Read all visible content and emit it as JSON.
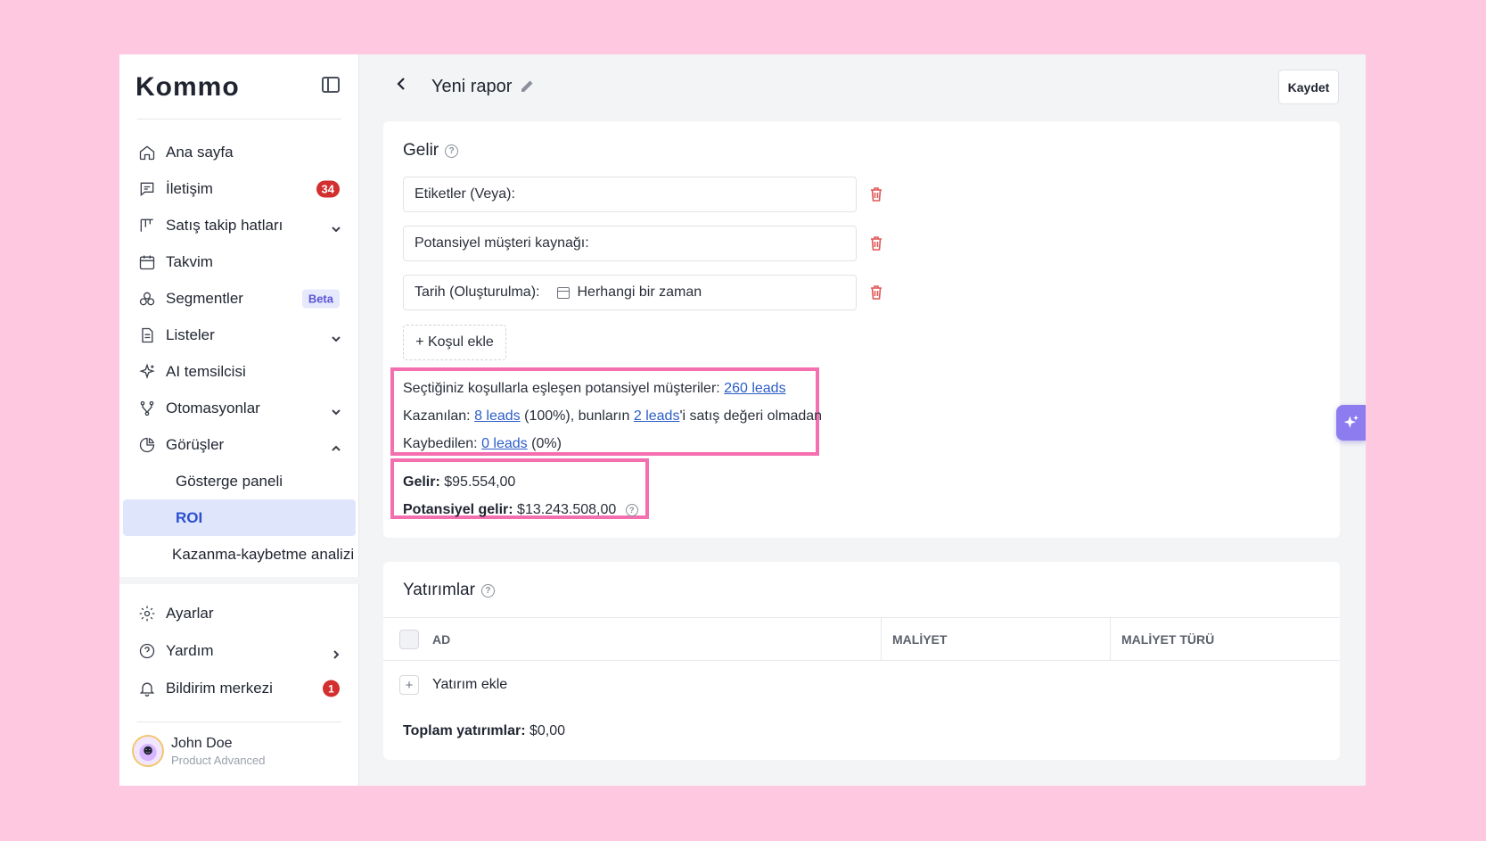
{
  "app": {
    "logo": "Kommo"
  },
  "sidebar": {
    "items": [
      {
        "label": "Ana sayfa",
        "icon": "home-icon"
      },
      {
        "label": "İletişim",
        "icon": "chat-icon",
        "badge": "34"
      },
      {
        "label": "Satış takip hatları",
        "icon": "pipeline-icon",
        "chevron": "down"
      },
      {
        "label": "Takvim",
        "icon": "calendar-icon"
      },
      {
        "label": "Segmentler",
        "icon": "segments-icon",
        "badge": "Beta"
      },
      {
        "label": "Listeler",
        "icon": "list-icon",
        "chevron": "down"
      },
      {
        "label": "AI temsilcisi",
        "icon": "sparkle-icon"
      },
      {
        "label": "Otomasyonlar",
        "icon": "automation-icon",
        "chevron": "down"
      },
      {
        "label": "Görüşler",
        "icon": "pie-chart-icon",
        "chevron": "up"
      }
    ],
    "sub_items": [
      "Gösterge paneli",
      "ROI",
      "Kazanma-kaybetme analizi"
    ],
    "active_sub": "ROI",
    "bottom_items": [
      {
        "label": "Ayarlar",
        "icon": "gear-icon"
      },
      {
        "label": "Yardım",
        "icon": "help-icon",
        "chevron": "right"
      },
      {
        "label": "Bildirim merkezi",
        "icon": "bell-icon",
        "badge": "1"
      }
    ],
    "profile": {
      "name": "John Doe",
      "plan": "Product Advanced"
    }
  },
  "header": {
    "title": "Yeni rapor",
    "save_label": "Kaydet"
  },
  "income": {
    "title": "Gelir",
    "conditions": [
      {
        "label": "Etiketler (Veya):",
        "value": ""
      },
      {
        "label": "Potansiyel müşteri kaynağı:",
        "value": ""
      },
      {
        "label": "Tarih (Oluşturulma):",
        "value": "Herhangi bir zaman"
      }
    ],
    "add_condition": "+ Koşul ekle",
    "matching_text": "Seçtiğiniz koşullarla eşleşen potansiyel müşteriler:",
    "matching_link": "260 leads",
    "won_text": "Kazanılan:",
    "won_link": "8 leads",
    "won_pct": "(100%), bunların",
    "won_no_value_link": "2 leads",
    "won_suffix": "'i satış değeri olmadan",
    "lost_text": "Kaybedilen:",
    "lost_link": "0 leads",
    "lost_pct": "(0%)",
    "revenue_label": "Gelir:",
    "revenue_value": "$95.554,00",
    "potential_label": "Potansiyel gelir:",
    "potential_value": "$13.243.508,00"
  },
  "investments": {
    "title": "Yatırımlar",
    "columns": [
      "AD",
      "MALİYET",
      "MALİYET TÜRÜ"
    ],
    "add_label": "Yatırım ekle",
    "total_label": "Toplam yatırımlar:",
    "total_value": "$0,00"
  },
  "colors": {
    "accent": "#2b4fd0",
    "highlight": "#f46fb0",
    "badge": "#d32f2f",
    "background": "#fec9e0"
  }
}
